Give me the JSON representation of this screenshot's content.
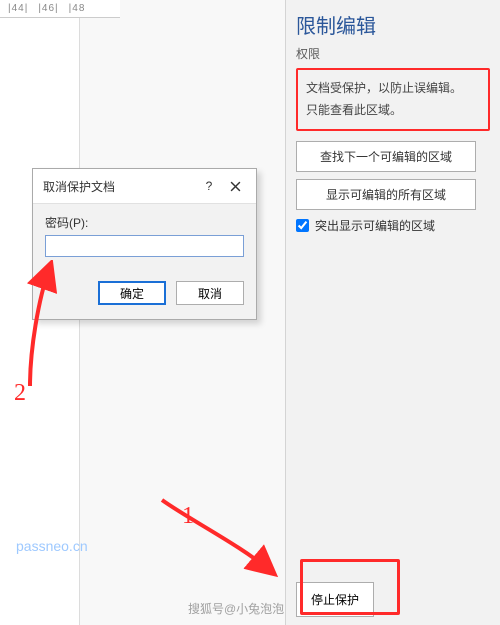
{
  "ruler": {
    "t1": "|44|",
    "t2": "|46|",
    "t3": "|48"
  },
  "pane": {
    "title": "限制编辑",
    "sub": "权限",
    "notice_l1": "文档受保护，以防止误编辑。",
    "notice_l2": "只能查看此区域。",
    "btn_find": "查找下一个可编辑的区域",
    "btn_showall": "显示可编辑的所有区域",
    "chk_highlight": "突出显示可编辑的区域",
    "btn_stop": "停止保护"
  },
  "dialog": {
    "title": "取消保护文档",
    "help": "?",
    "pwd_label": "密码(P):",
    "pwd_value": "",
    "ok": "确定",
    "cancel": "取消"
  },
  "anno": {
    "n1": "1",
    "n2": "2"
  },
  "watermark": {
    "w1": "passneo.cn",
    "w2": "搜狐号@小兔泡泡"
  }
}
